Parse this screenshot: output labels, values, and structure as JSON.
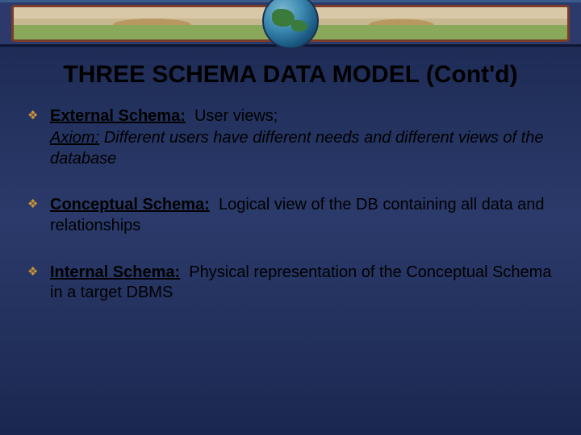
{
  "title": "THREE SCHEMA DATA MODEL (Cont'd)",
  "bullets": [
    {
      "label": "External Schema:",
      "text": "User views;",
      "axiom_lead": "Axiom:",
      "axiom_text": "Different users have different needs and different views of the database"
    },
    {
      "label": "Conceptual Schema:",
      "text": "Logical view of the DB containing all data and relationships"
    },
    {
      "label": "Internal Schema:",
      "text": "Physical representation  of the Conceptual Schema in a target DBMS"
    }
  ]
}
